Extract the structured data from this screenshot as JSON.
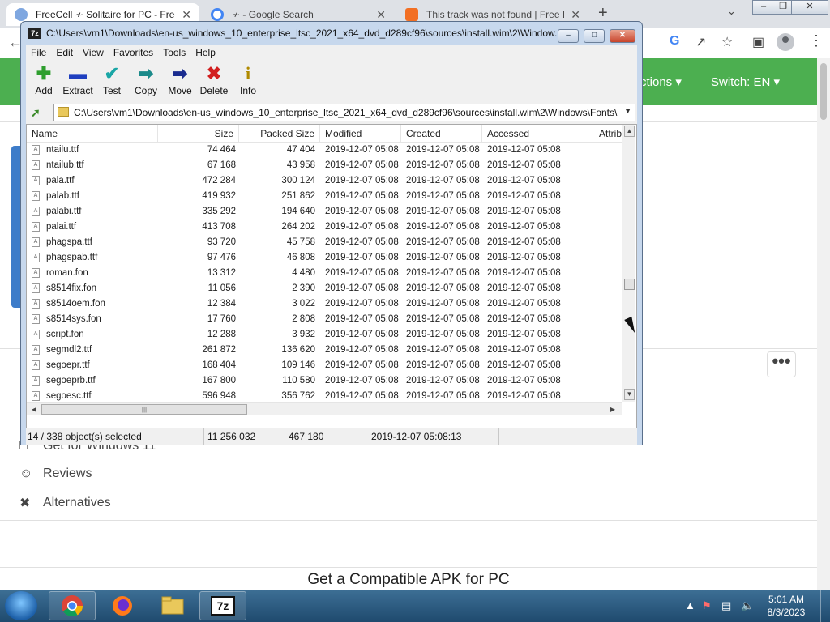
{
  "browser": {
    "tabs": [
      {
        "title": "FreeCell ≁ Solitaire for PC - Free",
        "icon_color": "#7fa7e0"
      },
      {
        "title": "≁ - Google Search",
        "icon_color": "#4285f4"
      },
      {
        "title": "This track was not found | Free L",
        "icon_color": "#f26f23"
      }
    ],
    "new_tab": "+",
    "close_glyph": "✕"
  },
  "site": {
    "nav_sections": "ctions ▾",
    "nav_switch_prefix": "Switch:",
    "nav_switch_value": "EN ▾",
    "more_button": "•••",
    "links": [
      {
        "label": "Get for Windows 11",
        "icon": "monitor-icon"
      },
      {
        "label": "Reviews",
        "icon": "people-icon"
      },
      {
        "label": "Alternatives",
        "icon": "tools-icon"
      }
    ],
    "apk_title": "Get a Compatible APK for PC",
    "accent_color": "#4caf50"
  },
  "zip": {
    "title": "C:\\Users\\vm1\\Downloads\\en-us_windows_10_enterprise_ltsc_2021_x64_dvd_d289cf96\\sources\\install.wim\\2\\Window...",
    "logo": "7z",
    "menu": [
      "File",
      "Edit",
      "View",
      "Favorites",
      "Tools",
      "Help"
    ],
    "tools": [
      {
        "label": "Add",
        "glyph": "✚",
        "color": "#2e9e2e"
      },
      {
        "label": "Extract",
        "glyph": "▬",
        "color": "#1f3fbf"
      },
      {
        "label": "Test",
        "glyph": "✔",
        "color": "#1aa6a6"
      },
      {
        "label": "Copy",
        "glyph": "➡",
        "color": "#1b8a8a"
      },
      {
        "label": "Move",
        "glyph": "➡",
        "color": "#1a2c8f"
      },
      {
        "label": "Delete",
        "glyph": "✖",
        "color": "#d21f1f"
      },
      {
        "label": "Info",
        "glyph": "i",
        "color": "#b08a00"
      }
    ],
    "address": "C:\\Users\\vm1\\Downloads\\en-us_windows_10_enterprise_ltsc_2021_x64_dvd_d289cf96\\sources\\install.wim\\2\\Windows\\Fonts\\",
    "columns": [
      "Name",
      "Size",
      "Packed Size",
      "Modified",
      "Created",
      "Accessed",
      "Attrib"
    ],
    "rows": [
      {
        "name": "ntailu.ttf",
        "size": "74 464",
        "packed": "47 404",
        "modified": "2019-12-07 05:08",
        "created": "2019-12-07 05:08",
        "accessed": "2019-12-07 05:08"
      },
      {
        "name": "ntailub.ttf",
        "size": "67 168",
        "packed": "43 958",
        "modified": "2019-12-07 05:08",
        "created": "2019-12-07 05:08",
        "accessed": "2019-12-07 05:08"
      },
      {
        "name": "pala.ttf",
        "size": "472 284",
        "packed": "300 124",
        "modified": "2019-12-07 05:08",
        "created": "2019-12-07 05:08",
        "accessed": "2019-12-07 05:08"
      },
      {
        "name": "palab.ttf",
        "size": "419 932",
        "packed": "251 862",
        "modified": "2019-12-07 05:08",
        "created": "2019-12-07 05:08",
        "accessed": "2019-12-07 05:08"
      },
      {
        "name": "palabi.ttf",
        "size": "335 292",
        "packed": "194 640",
        "modified": "2019-12-07 05:08",
        "created": "2019-12-07 05:08",
        "accessed": "2019-12-07 05:08"
      },
      {
        "name": "palai.ttf",
        "size": "413 708",
        "packed": "264 202",
        "modified": "2019-12-07 05:08",
        "created": "2019-12-07 05:08",
        "accessed": "2019-12-07 05:08"
      },
      {
        "name": "phagspa.ttf",
        "size": "93 720",
        "packed": "45 758",
        "modified": "2019-12-07 05:08",
        "created": "2019-12-07 05:08",
        "accessed": "2019-12-07 05:08"
      },
      {
        "name": "phagspab.ttf",
        "size": "97 476",
        "packed": "46 808",
        "modified": "2019-12-07 05:08",
        "created": "2019-12-07 05:08",
        "accessed": "2019-12-07 05:08"
      },
      {
        "name": "roman.fon",
        "size": "13 312",
        "packed": "4 480",
        "modified": "2019-12-07 05:08",
        "created": "2019-12-07 05:08",
        "accessed": "2019-12-07 05:08"
      },
      {
        "name": "s8514fix.fon",
        "size": "11 056",
        "packed": "2 390",
        "modified": "2019-12-07 05:08",
        "created": "2019-12-07 05:08",
        "accessed": "2019-12-07 05:08"
      },
      {
        "name": "s8514oem.fon",
        "size": "12 384",
        "packed": "3 022",
        "modified": "2019-12-07 05:08",
        "created": "2019-12-07 05:08",
        "accessed": "2019-12-07 05:08"
      },
      {
        "name": "s8514sys.fon",
        "size": "17 760",
        "packed": "2 808",
        "modified": "2019-12-07 05:08",
        "created": "2019-12-07 05:08",
        "accessed": "2019-12-07 05:08"
      },
      {
        "name": "script.fon",
        "size": "12 288",
        "packed": "3 932",
        "modified": "2019-12-07 05:08",
        "created": "2019-12-07 05:08",
        "accessed": "2019-12-07 05:08"
      },
      {
        "name": "segmdl2.ttf",
        "size": "261 872",
        "packed": "136 620",
        "modified": "2019-12-07 05:08",
        "created": "2019-12-07 05:08",
        "accessed": "2019-12-07 05:08"
      },
      {
        "name": "segoepr.ttf",
        "size": "168 404",
        "packed": "109 146",
        "modified": "2019-12-07 05:08",
        "created": "2019-12-07 05:08",
        "accessed": "2019-12-07 05:08"
      },
      {
        "name": "segoeprb.ttf",
        "size": "167 800",
        "packed": "110 580",
        "modified": "2019-12-07 05:08",
        "created": "2019-12-07 05:08",
        "accessed": "2019-12-07 05:08"
      },
      {
        "name": "segoesc.ttf",
        "size": "596 948",
        "packed": "356 762",
        "modified": "2019-12-07 05:08",
        "created": "2019-12-07 05:08",
        "accessed": "2019-12-07 05:08"
      }
    ],
    "status": {
      "selection": "14 / 338 object(s) selected",
      "size": "11 256 032",
      "packed": "467 180",
      "date": "2019-12-07 05:08:13"
    }
  },
  "taskbar": {
    "time": "5:01 AM",
    "date": "8/3/2023",
    "apps": [
      "chrome-icon",
      "firefox-icon",
      "explorer-icon",
      "7zip-icon"
    ],
    "zip_label": "7z"
  }
}
